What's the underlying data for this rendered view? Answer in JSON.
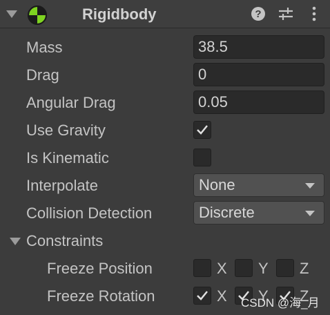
{
  "component": {
    "title": "Rigidbody",
    "icon": "rigidbody-physics-icon",
    "icon_colors": {
      "fill": "#7ed321",
      "ring": "#1b1b1b"
    },
    "header_buttons": [
      "help-icon",
      "preset-sliders-icon",
      "more-vertical-icon"
    ],
    "help_glyph": "?"
  },
  "properties": {
    "mass": {
      "label": "Mass",
      "value": "38.5"
    },
    "drag": {
      "label": "Drag",
      "value": "0"
    },
    "angular_drag": {
      "label": "Angular Drag",
      "value": "0.05"
    },
    "use_gravity": {
      "label": "Use Gravity",
      "checked": true
    },
    "is_kinematic": {
      "label": "Is Kinematic",
      "checked": false
    },
    "interpolate": {
      "label": "Interpolate",
      "selected": "None"
    },
    "collision_detection": {
      "label": "Collision Detection",
      "selected": "Discrete"
    }
  },
  "constraints": {
    "label": "Constraints",
    "expanded": true,
    "axis_labels": [
      "X",
      "Y",
      "Z"
    ],
    "freeze_position": {
      "label": "Freeze Position",
      "x": false,
      "y": false,
      "z": false
    },
    "freeze_rotation": {
      "label": "Freeze Rotation",
      "x": true,
      "y": true,
      "z": true
    }
  },
  "watermark": "CSDN @海_月",
  "colors": {
    "background": "#3c3c3c",
    "field_background": "#2a2a2a",
    "dropdown_background": "#515151",
    "text": "#c4c4c4"
  }
}
